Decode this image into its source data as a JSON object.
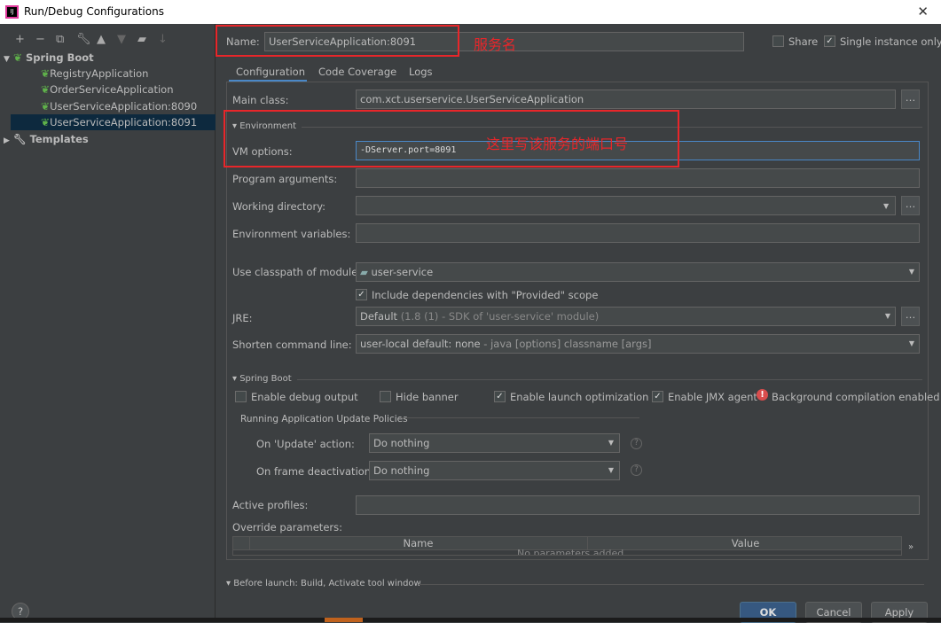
{
  "window": {
    "title": "Run/Debug Configurations",
    "app_icon": "IJ",
    "close": "✕"
  },
  "toolbar": [
    "add-icon",
    "remove-icon",
    "copy-icon",
    "wrench-icon",
    "up-icon",
    "down-icon",
    "folder-icon",
    "sort-icon"
  ],
  "tree": {
    "root": "Spring Boot",
    "items": [
      "RegistryApplication",
      "OrderServiceApplication",
      "UserServiceApplication:8090",
      "UserServiceApplication:8091"
    ],
    "templates": "Templates",
    "selected": 3
  },
  "name": {
    "label": "Name:",
    "value": "UserServiceApplication:8091",
    "share": "Share",
    "share_checked": false,
    "single_instance": "Single instance only",
    "single_checked": true
  },
  "tabs": [
    "Configuration",
    "Code Coverage",
    "Logs"
  ],
  "config": {
    "main_class_label": "Main class:",
    "main_class": "com.xct.userservice.UserServiceApplication",
    "environment": "Environment",
    "vm_label": "VM options:",
    "vm_value": "-DServer.port=8091",
    "program_args_label": "Program arguments:",
    "working_dir_label": "Working directory:",
    "env_vars_label": "Environment variables:",
    "classpath_label": "Use classpath of module:",
    "classpath_value": "user-service",
    "include_deps": "Include dependencies with \"Provided\" scope",
    "jre_label": "JRE:",
    "jre_value": "Default",
    "jre_hint": "(1.8 (1) - SDK of 'user-service' module)",
    "shorten_label": "Shorten command line:",
    "shorten_value": "user-local default: none",
    "shorten_hint": "- java [options] classname [args]",
    "spring_boot": "Spring Boot",
    "debug_output": "Enable debug output",
    "hide_banner": "Hide banner",
    "launch_opt": "Enable launch optimization",
    "jmx": "Enable JMX agent",
    "bg_compile": "Background compilation enabled",
    "policies": "Running Application Update Policies",
    "update_label": "On 'Update' action:",
    "update_value": "Do nothing",
    "frame_label": "On frame deactivation:",
    "frame_value": "Do nothing",
    "profiles_label": "Active profiles:",
    "override_label": "Override parameters:",
    "col_name": "Name",
    "col_value": "Value",
    "empty": "No parameters added."
  },
  "before_launch": "Before launch: Build, Activate tool window",
  "buttons": {
    "ok": "OK",
    "cancel": "Cancel",
    "apply": "Apply",
    "help": "?"
  },
  "annotations": {
    "name": "服务名",
    "vm": "这里写该服务的端口号",
    "color": "#e8262a"
  }
}
